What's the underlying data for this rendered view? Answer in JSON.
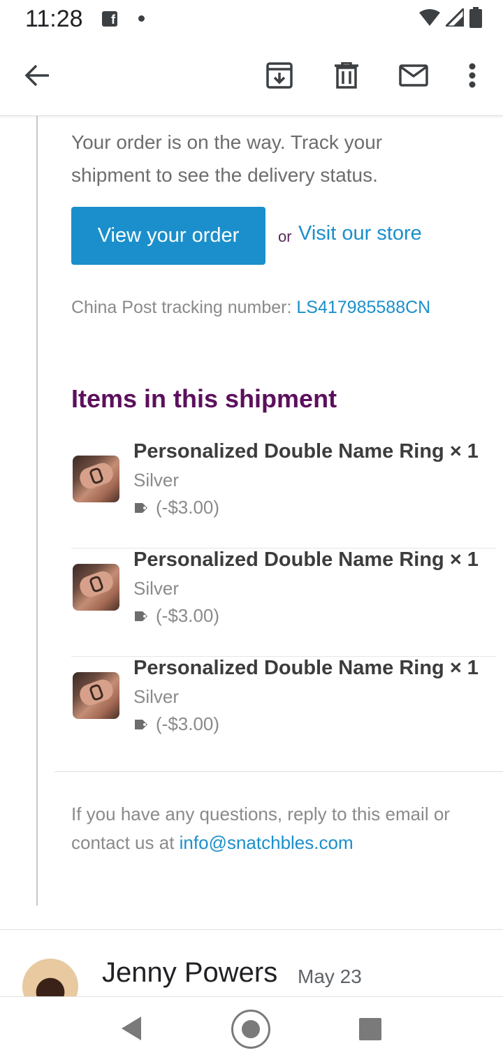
{
  "status_bar": {
    "time": "11:28",
    "fb_letter": "f"
  },
  "app_bar": {
    "icons": [
      "back-arrow-icon",
      "archive-icon",
      "delete-icon",
      "mark-unread-icon",
      "more-vert-icon"
    ]
  },
  "email": {
    "intro": "Your order is on the way. Track your shipment to see the delivery status.",
    "view_order_button": "View your order",
    "or_text": "or",
    "visit_store_link": "Visit our store",
    "tracking_label": "China Post tracking number:",
    "tracking_number": "LS417985588CN",
    "items_heading": "Items in this shipment",
    "items": [
      {
        "name": "Personalized Double Name Ring × 1",
        "variant": "Silver",
        "discount": "(-$3.00)"
      },
      {
        "name": "Personalized Double Name Ring × 1",
        "variant": "Silver",
        "discount": "(-$3.00)"
      },
      {
        "name": "Personalized Double Name Ring × 1",
        "variant": "Silver",
        "discount": "(-$3.00)"
      }
    ],
    "footer_text": "If you have any questions, reply to this email or contact us at",
    "footer_email": "info@snatchbles.com"
  },
  "next_message": {
    "sender": "Jenny Powers",
    "date": "May 23"
  },
  "colors": {
    "accent": "#1b8fcb",
    "heading": "#5c0f5c"
  }
}
